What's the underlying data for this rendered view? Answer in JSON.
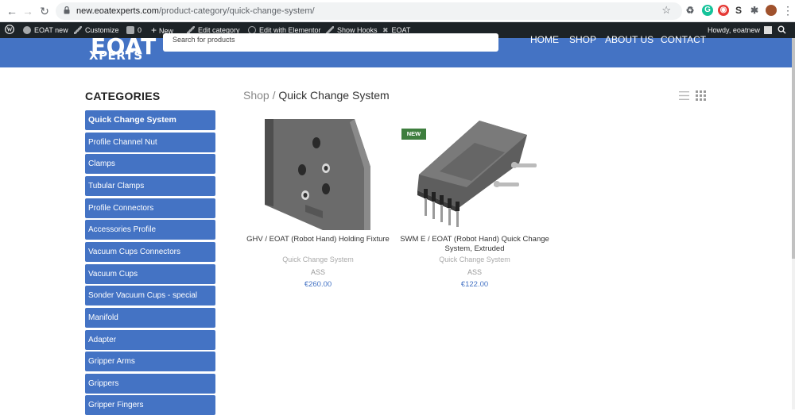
{
  "browser": {
    "url_host": "new.eoatexperts.com",
    "url_path": "/product-category/quick-change-system/"
  },
  "wp_admin_bar": {
    "site_name": "EOAT new",
    "customize": "Customize",
    "comments_count": "0",
    "new": "New",
    "edit_category": "Edit category",
    "edit_elementor": "Edit with Elementor",
    "show_hooks": "Show Hooks",
    "eoat": "EOAT",
    "howdy": "Howdy, eoatnew"
  },
  "header": {
    "logo_line1": "EOAT",
    "logo_line2": "XPERTS",
    "search_placeholder": "Search for products",
    "menu": [
      "HOME",
      "SHOP",
      "ABOUT US",
      "CONTACT"
    ]
  },
  "sidebar": {
    "heading": "CATEGORIES",
    "items": [
      "Quick Change System",
      "Profile Channel Nut",
      "Clamps",
      "Tubular Clamps",
      "Profile Connectors",
      "Accessories Profile",
      "Vacuum Cups Connectors",
      "Vacuum Cups",
      "Sonder Vacuum Cups - special",
      "Manifold",
      "Adapter",
      "Gripper Arms",
      "Grippers",
      "Gripper Fingers"
    ]
  },
  "breadcrumb": {
    "shop": "Shop",
    "separator": "/",
    "current": "Quick Change System"
  },
  "products": [
    {
      "title": "GHV / EOAT (Robot Hand) Holding Fixture",
      "category": "Quick Change System",
      "sku": "ASS",
      "price": "€260.00"
    },
    {
      "badge": "NEW",
      "title": "SWM E / EOAT (Robot Hand) Quick Change System, Extruded",
      "category": "Quick Change System",
      "sku": "ASS",
      "price": "€122.00"
    }
  ],
  "colors": {
    "brand_blue": "#4473c4",
    "admin_bar": "#1d2327",
    "badge_green": "#3e7e3e"
  }
}
